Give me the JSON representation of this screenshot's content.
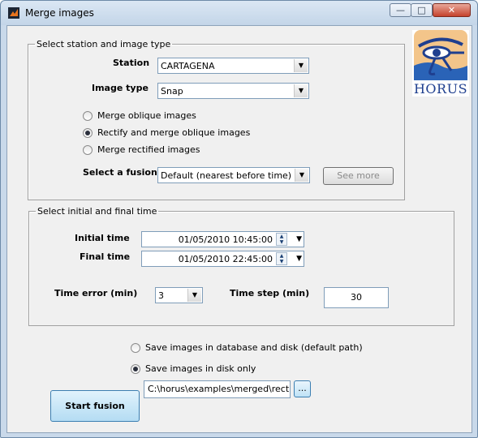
{
  "window": {
    "title": "Merge images",
    "min_glyph": "—",
    "max_glyph": "□",
    "close_glyph": "✕"
  },
  "station_group": {
    "legend": "Select station and image type",
    "station_label": "Station",
    "station_value": "CARTAGENA",
    "image_type_label": "Image type",
    "image_type_value": "Snap",
    "radios": [
      {
        "label": "Merge oblique images",
        "selected": false
      },
      {
        "label": "Rectify and merge oblique images",
        "selected": true
      },
      {
        "label": "Merge rectified images",
        "selected": false
      }
    ],
    "fusion_label": "Select a fusion",
    "fusion_value": "Default (nearest before time)",
    "see_more_label": "See more"
  },
  "logo": {
    "text": "HORUS"
  },
  "time_group": {
    "legend": "Select initial and final time",
    "initial_label": "Initial time",
    "initial_value": "01/05/2010 10:45:00",
    "final_label": "Final time",
    "final_value": "01/05/2010 22:45:00",
    "error_label": "Time error (min)",
    "error_value": "3",
    "step_label": "Time step (min)",
    "step_value": "30"
  },
  "save": {
    "options": [
      {
        "label": "Save images in database and disk (default path)",
        "selected": false
      },
      {
        "label": "Save images in disk only",
        "selected": true
      }
    ],
    "path_value": "C:\\horus\\examples\\merged\\rectified",
    "browse_label": "..."
  },
  "start_button_label": "Start fusion",
  "colors": {
    "start_button_bg": "#bfe3f7",
    "logo_blue": "#1f3f8f"
  }
}
